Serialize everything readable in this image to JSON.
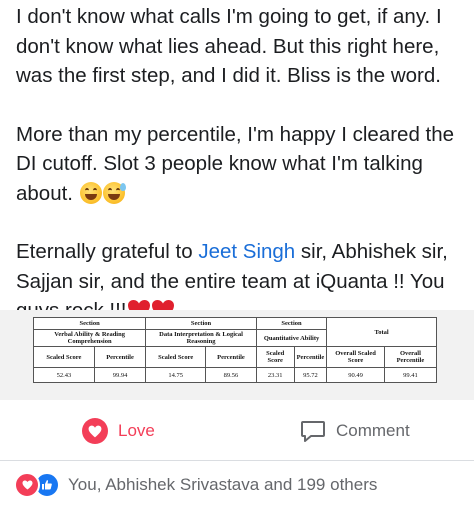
{
  "post": {
    "p1": "I don't know what calls I'm going to get, if any. I don't know what lies ahead. But this right here, was the first step, and I did it. Bliss is the word.",
    "p2": "More than my percentile, I'm happy I cleared the DI cutoff. Slot 3 people know what I'm talking about.",
    "p3_before": "Eternally grateful to ",
    "mention": "Jeet Singh",
    "p3_after": " sir, Abhishek sir, Sajjan sir, and the entire team at iQuanta !! You guys rock !!!",
    "emoji_p2": [
      "grinning-squinting-face",
      "grinning-face-with-sweat"
    ],
    "emoji_p3": [
      "red-heart",
      "red-heart"
    ],
    "mention_color": "#1a6ed8"
  },
  "scorecard": {
    "section_label": "Section",
    "sections": [
      "Verbal Ability & Reading Comprehension",
      "Data Interpretation & Logical Reasoning",
      "Quantitative Ability"
    ],
    "total_label": "Total",
    "col_scaled": "Scaled Score",
    "col_percentile": "Percentile",
    "col_overall_scaled": "Overall Scaled Score",
    "col_overall_percentile": "Overall Percentile",
    "values": [
      "52.43",
      "99.94",
      "14.75",
      "89.56",
      "23.31",
      "95.72",
      "90.49",
      "99.41"
    ]
  },
  "actions": {
    "love_label": "Love",
    "comment_label": "Comment",
    "love_color": "#f33e58"
  },
  "reactions": {
    "summary": "You, Abhishek Srivastava and 199 others",
    "icons": [
      "love-icon",
      "like-icon"
    ]
  }
}
